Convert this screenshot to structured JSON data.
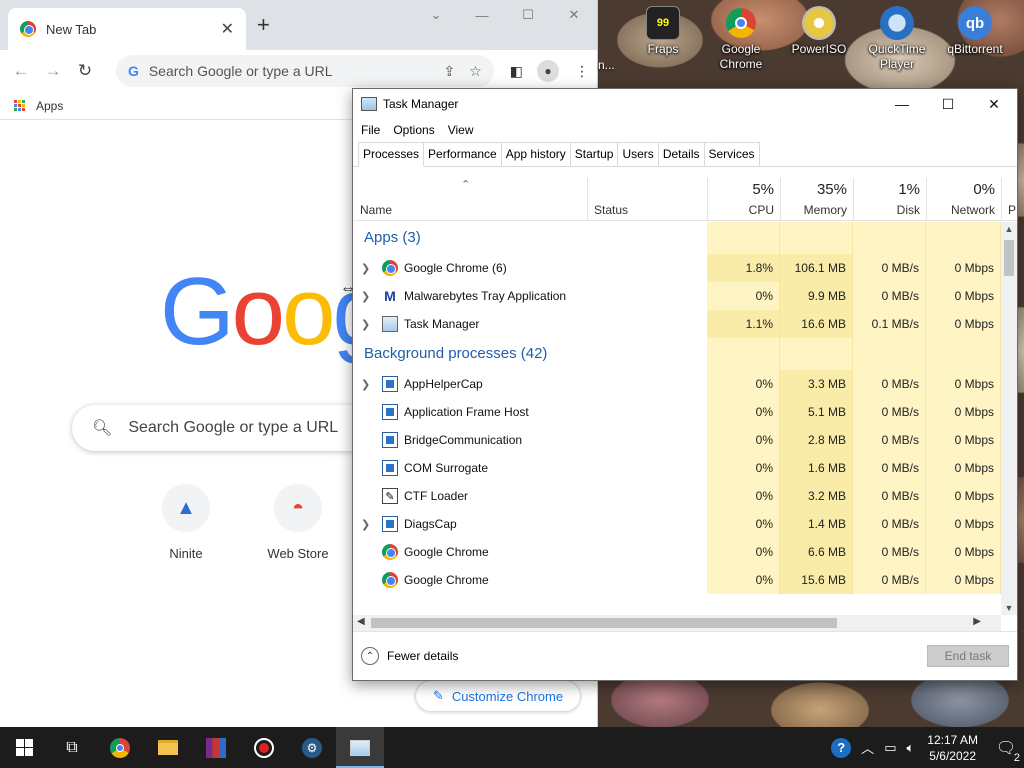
{
  "chrome": {
    "tab_title": "New Tab",
    "omnibox_placeholder": "Search Google or type a URL",
    "bookmarks": {
      "apps_label": "Apps"
    },
    "logo_text": [
      "G",
      "o",
      "o",
      "g"
    ],
    "search_placeholder": "Search Google or type a URL",
    "shortcuts": [
      {
        "label": "Ninite"
      },
      {
        "label": "Web Store"
      }
    ],
    "customize_label": "Customize Chrome"
  },
  "desktop": {
    "partial_label": "n...",
    "icons": [
      {
        "label": "Fraps",
        "icon": "fraps-icon"
      },
      {
        "label": "Google Chrome",
        "icon": "chrome-icon"
      },
      {
        "label": "PowerISO",
        "icon": "poweriso-icon"
      },
      {
        "label": "QuickTime Player",
        "icon": "quicktime-icon"
      },
      {
        "label": "qBittorrent",
        "icon": "qbittorrent-icon"
      }
    ]
  },
  "task_manager": {
    "title": "Task Manager",
    "menu": [
      "File",
      "Options",
      "View"
    ],
    "tabs": [
      "Processes",
      "Performance",
      "App history",
      "Startup",
      "Users",
      "Details",
      "Services"
    ],
    "active_tab": "Processes",
    "columns": {
      "name": "Name",
      "status": "Status",
      "cpu": {
        "percent": "5%",
        "label": "CPU"
      },
      "memory": {
        "percent": "35%",
        "label": "Memory"
      },
      "disk": {
        "percent": "1%",
        "label": "Disk"
      },
      "network": {
        "percent": "0%",
        "label": "Network"
      },
      "power_partial": "P"
    },
    "groups": {
      "apps": "Apps (3)",
      "background": "Background processes (42)"
    },
    "apps": [
      {
        "name": "Google Chrome (6)",
        "icon": "chrome",
        "expandable": true,
        "cpu": "1.8%",
        "memory": "106.1 MB",
        "disk": "0 MB/s",
        "network": "0 Mbps"
      },
      {
        "name": "Malwarebytes Tray Application",
        "icon": "malwarebytes",
        "expandable": true,
        "cpu": "0%",
        "memory": "9.9 MB",
        "disk": "0 MB/s",
        "network": "0 Mbps"
      },
      {
        "name": "Task Manager",
        "icon": "taskmanager",
        "expandable": true,
        "cpu": "1.1%",
        "memory": "16.6 MB",
        "disk": "0.1 MB/s",
        "network": "0 Mbps"
      }
    ],
    "background": [
      {
        "name": "AppHelperCap",
        "icon": "window",
        "expandable": true,
        "cpu": "0%",
        "memory": "3.3 MB",
        "disk": "0 MB/s",
        "network": "0 Mbps"
      },
      {
        "name": "Application Frame Host",
        "icon": "window",
        "expandable": false,
        "cpu": "0%",
        "memory": "5.1 MB",
        "disk": "0 MB/s",
        "network": "0 Mbps"
      },
      {
        "name": "BridgeCommunication",
        "icon": "window",
        "expandable": false,
        "cpu": "0%",
        "memory": "2.8 MB",
        "disk": "0 MB/s",
        "network": "0 Mbps"
      },
      {
        "name": "COM Surrogate",
        "icon": "window",
        "expandable": false,
        "cpu": "0%",
        "memory": "1.6 MB",
        "disk": "0 MB/s",
        "network": "0 Mbps"
      },
      {
        "name": "CTF Loader",
        "icon": "ctf",
        "expandable": false,
        "cpu": "0%",
        "memory": "3.2 MB",
        "disk": "0 MB/s",
        "network": "0 Mbps"
      },
      {
        "name": "DiagsCap",
        "icon": "window",
        "expandable": true,
        "cpu": "0%",
        "memory": "1.4 MB",
        "disk": "0 MB/s",
        "network": "0 Mbps"
      },
      {
        "name": "Google Chrome",
        "icon": "chrome",
        "expandable": false,
        "cpu": "0%",
        "memory": "6.6 MB",
        "disk": "0 MB/s",
        "network": "0 Mbps"
      },
      {
        "name": "Google Chrome",
        "icon": "chrome",
        "expandable": false,
        "cpu": "0%",
        "memory": "15.6 MB",
        "disk": "0 MB/s",
        "network": "0 Mbps"
      }
    ],
    "footer": {
      "fewer_details": "Fewer details",
      "end_task": "End task"
    }
  },
  "taskbar": {
    "apps": [
      "start",
      "task-view",
      "chrome",
      "file-explorer",
      "winrar",
      "obs",
      "steam",
      "task-manager"
    ],
    "clock_time": "12:17 AM",
    "clock_date": "5/6/2022",
    "notification_count": "2"
  }
}
